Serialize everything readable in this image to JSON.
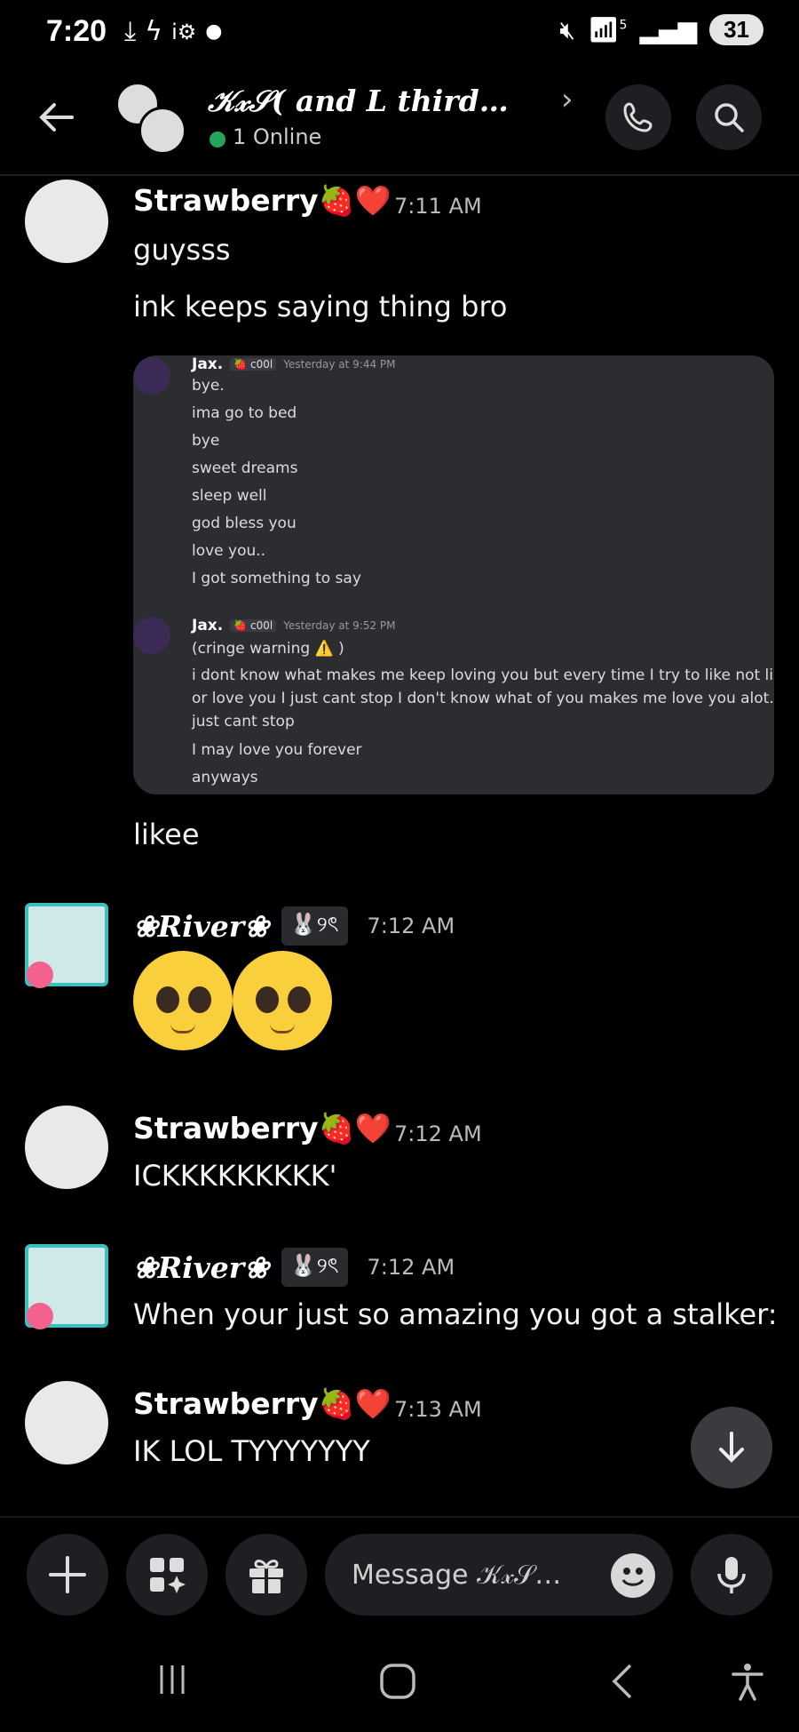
{
  "status_bar": {
    "time": "7:20",
    "left_icons": [
      "download-icon",
      "bolt-icon",
      "wifi-assist-icon",
      "dot-icon"
    ],
    "wifi_label": "5",
    "battery": "31"
  },
  "header": {
    "title": "𝒦𝓍𝒮( and L third…",
    "online": "1 Online",
    "online_color": "#23a55a"
  },
  "messages": [
    {
      "user": "Strawberry🍓❤️",
      "time": "7:11 AM",
      "lines": [
        "guysss",
        "ink keeps saying thing bro"
      ]
    },
    {
      "user": "Strawberry🍓❤️",
      "time": "",
      "lines": [
        "likee"
      ]
    },
    {
      "user": "❀River❀",
      "tag": "🐰୨ৎ",
      "time": "7:12 AM",
      "lines": []
    },
    {
      "user": "Strawberry🍓❤️",
      "time": "7:12 AM",
      "lines": [
        "ICKKKKKKKKK'"
      ]
    },
    {
      "user": "❀River❀",
      "tag": "🐰୨ৎ",
      "time": "7:12 AM",
      "lines": [
        "When your just so amazing you got a stalker:"
      ]
    },
    {
      "user": "Strawberry🍓❤️",
      "time": "7:13 AM",
      "lines": [
        "IK LOL TYYYYYYY"
      ]
    }
  ],
  "embed": {
    "block1": {
      "name": "Jax.",
      "tag": "🍓 c00l",
      "time": "Yesterday at 9:44 PM",
      "lines": [
        "bye.",
        "ima go to bed",
        "bye",
        "sweet dreams",
        "sleep well",
        "god bless you",
        "love you..",
        "I got something to say"
      ]
    },
    "block2": {
      "name": "Jax.",
      "tag": "🍓 c00l",
      "time": "Yesterday at 9:52 PM",
      "lines": [
        "(cringe warning ⚠️ )",
        "i dont know what makes me keep loving you but every time I try to like not like",
        "or love you I just cant stop I don't know what of you makes me love you alot. I",
        "just cant stop",
        "I may love you forever",
        "anyways"
      ]
    }
  },
  "composer": {
    "placeholder": "Message 𝒦𝓍𝒮…"
  }
}
